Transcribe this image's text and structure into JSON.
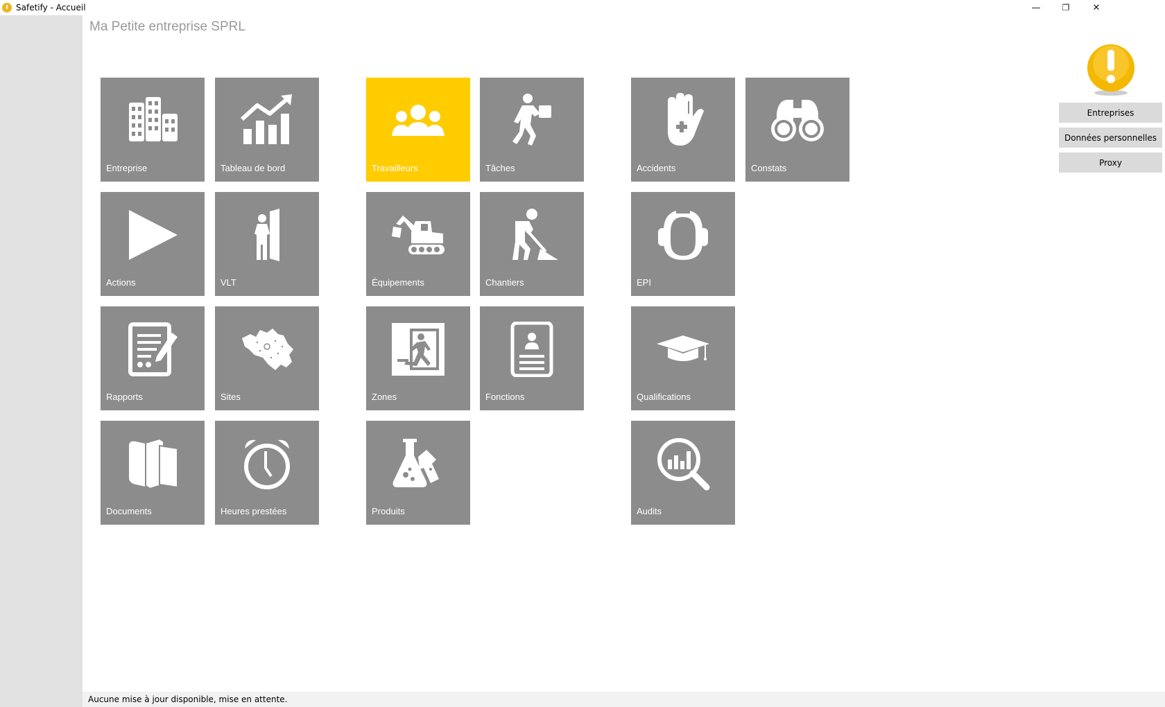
{
  "window": {
    "title": "Safetify - Accueil",
    "minimize": "—",
    "restore": "❐",
    "close": "✕"
  },
  "company": "Ma Petite entreprise SPRL",
  "tiles": [
    {
      "label": "Entreprise",
      "icon": "buildings-icon"
    },
    {
      "label": "Tableau de bord",
      "icon": "chart-growth-icon"
    },
    {
      "label": "Travailleurs",
      "icon": "workers-icon",
      "active": true
    },
    {
      "label": "Tâches",
      "icon": "worker-carrying-icon"
    },
    {
      "label": "Accidents",
      "icon": "hand-cross-icon"
    },
    {
      "label": "Constats",
      "icon": "binoculars-icon"
    },
    {
      "label": "Actions",
      "icon": "play-icon"
    },
    {
      "label": "VLT",
      "icon": "person-door-icon"
    },
    {
      "label": "Équipements",
      "icon": "excavator-icon"
    },
    {
      "label": "Chantiers",
      "icon": "digging-worker-icon"
    },
    {
      "label": "EPI",
      "icon": "ear-protection-icon"
    },
    {
      "label": "Rapports",
      "icon": "report-icon"
    },
    {
      "label": "Sites",
      "icon": "belgium-map-icon"
    },
    {
      "label": "Zones",
      "icon": "emergency-exit-icon"
    },
    {
      "label": "Fonctions",
      "icon": "id-card-icon"
    },
    {
      "label": "Qualifications",
      "icon": "graduation-cap-icon"
    },
    {
      "label": "Documents",
      "icon": "books-icon"
    },
    {
      "label": "Heures prestées",
      "icon": "alarm-clock-icon"
    },
    {
      "label": "Produits",
      "icon": "chemical-flasks-icon"
    },
    {
      "label": "Audits",
      "icon": "magnifier-chart-icon"
    }
  ],
  "right_buttons": {
    "entreprises": "Entreprises",
    "donnees": "Données personnelles",
    "proxy": "Proxy"
  },
  "status": "Aucune mise à jour disponible, mise en attente.",
  "colors": {
    "tile": "#8c8c8c",
    "tile_active": "#ffcc00",
    "sidebar": "#e2e2e2",
    "warning": "#f5b800"
  }
}
